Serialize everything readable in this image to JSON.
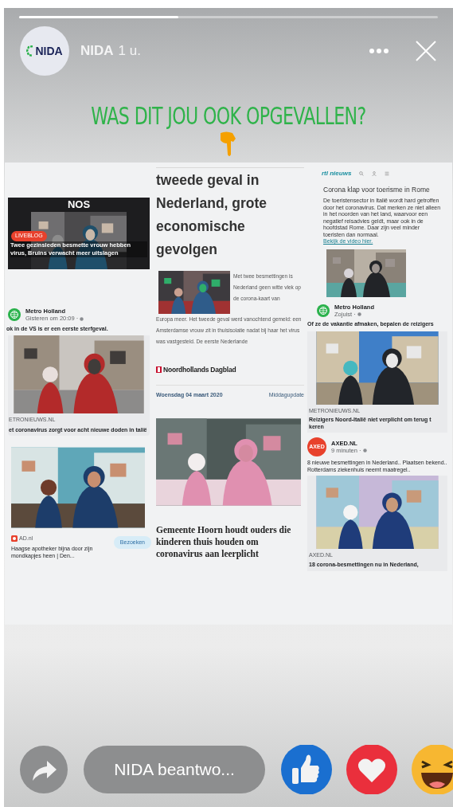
{
  "story": {
    "progress": {
      "level": 0.38
    },
    "avatar_text": "NIDA",
    "author": "NIDA",
    "time": "1 u."
  },
  "headline": "WAS DIT JOU OOK OPGEVALLEN?",
  "left": {
    "nos": {
      "logo": "NOS",
      "badge": "LIVEBLOG",
      "headline": "Twee gezinsleden besmette vrouw hebben virus, Bruins verwacht meer uitslagen"
    },
    "metro": {
      "page": "Metro Holland",
      "time": "Gisteren om 20:09 ·",
      "text": "ok in de VS is er een eerste sterfgeval.",
      "source": "ETRONIEUWS.NL",
      "title": "et coronavirus zorgt voor acht nieuwe doden in talië"
    },
    "ad": {
      "source": "AD.nl",
      "title": "Haagse apotheker bijna door zijn mondkapjes heen | Den...",
      "button": "Bezoeken"
    }
  },
  "middle": {
    "article": {
      "headline": "tweede geval in Nederland, grote economische gevolgen",
      "intro": "Met twee besmettingen is Nederland geen witte vlek op de corona-kaart van",
      "body": "Europa meer. Het tweede geval werd vanochtend gemeld: een Amsterdamse vrouw zit in thuisisolatie nadat bij haar het virus was vastgesteld. De eerste Nederlande"
    },
    "paper": {
      "name": "Noordhollands Dagblad",
      "date": "Woensdag 04 maart 2020",
      "edition": "Middagupdate",
      "headline": "Gemeente Hoorn houdt ouders die kinderen thuis houden om coronavirus aan leerplicht"
    }
  },
  "right": {
    "rtl": {
      "logo": "rtl nieuws",
      "title": "Corona klap voor toerisme in Rome",
      "text": "De toeristensector in Italië wordt hard getroffen door het coronavirus. Dat merken ze niet alleen in het noorden van het land, waarvoor een negatief reisadvies geldt, maar ook in de hoofdstad Rome. Daar zijn veel minder toeristen dan normaal.",
      "link": "Bekijk de video hier."
    },
    "metro": {
      "page": "Metro Holland",
      "time": "Zojuist ·",
      "text": "Of ze de vakantie afmaken, bepalen de reizigers",
      "source": "METRONIEUWS.NL",
      "title": "Reizigers Noord-Italië niet verplicht om terug t\nkeren"
    },
    "axed": {
      "logo": "AXED",
      "page": "AXED.NL",
      "time": "9 minuten ·",
      "text": "8 nieuwe besmettingen in Nederland.. Plaatsen bekend.. Rotterdams ziekenhuis neemt maatregel..",
      "source": "AXED.NL",
      "title": "18 corona-besmettingen nu in Nederland,"
    }
  },
  "reply": {
    "placeholder": "NIDA beantwo..."
  },
  "reactions": [
    {
      "kind": "like"
    },
    {
      "kind": "love"
    },
    {
      "kind": "haha"
    }
  ]
}
